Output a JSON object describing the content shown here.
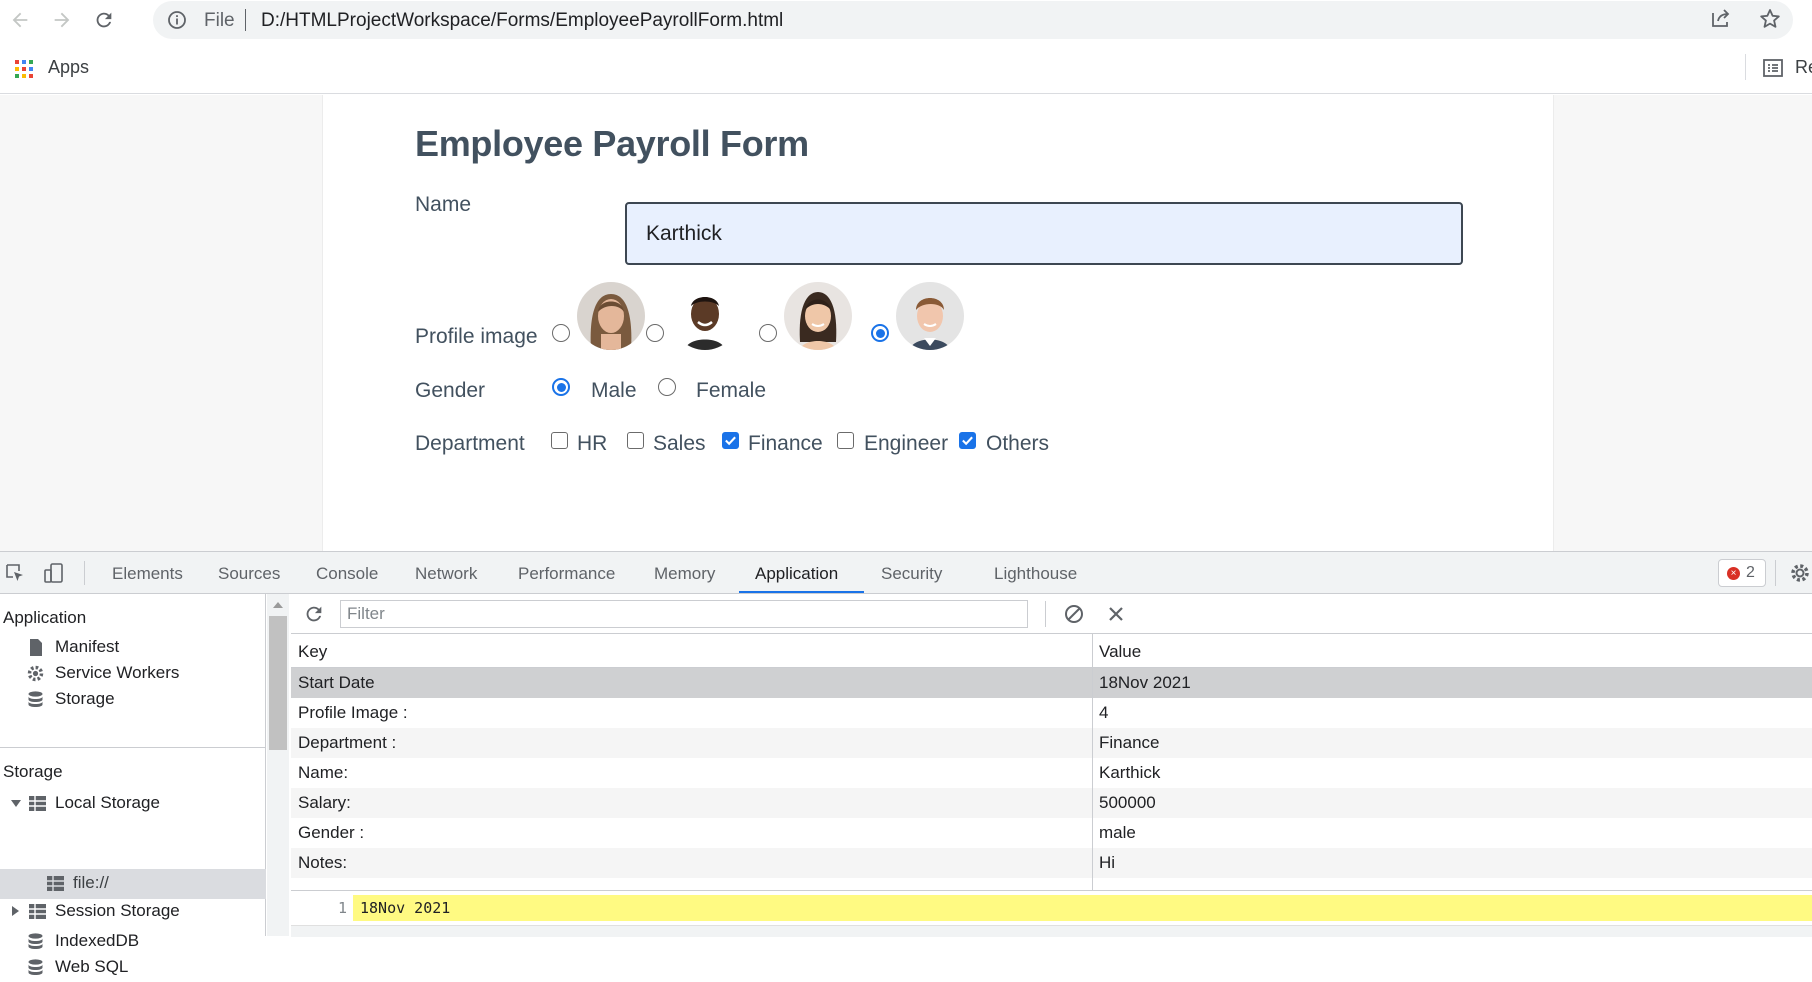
{
  "browser": {
    "url_scheme": "File",
    "url": "D:/HTMLProjectWorkspace/Forms/EmployeePayrollForm.html",
    "bookmarks": {
      "apps_label": "Apps",
      "reading_list_label": "Re"
    }
  },
  "form": {
    "title": "Employee Payroll Form",
    "name_label": "Name",
    "name_value": "Karthick",
    "profile_label": "Profile image",
    "profile_selected_index": 4,
    "gender_label": "Gender",
    "gender_options": [
      "Male",
      "Female"
    ],
    "gender_selected": "Male",
    "department_label": "Department",
    "departments": [
      {
        "label": "HR",
        "checked": false
      },
      {
        "label": "Sales",
        "checked": false
      },
      {
        "label": "Finance",
        "checked": true
      },
      {
        "label": "Engineer",
        "checked": false
      },
      {
        "label": "Others",
        "checked": true
      }
    ]
  },
  "devtools": {
    "tabs": [
      "Elements",
      "Sources",
      "Console",
      "Network",
      "Performance",
      "Memory",
      "Application",
      "Security",
      "Lighthouse"
    ],
    "active_tab": "Application",
    "error_count": "2",
    "sidebar": {
      "application_header": "Application",
      "application_items": [
        "Manifest",
        "Service Workers",
        "Storage"
      ],
      "storage_header": "Storage",
      "storage_items": [
        "Local Storage",
        "file://",
        "Session Storage",
        "IndexedDB",
        "Web SQL"
      ]
    },
    "storage": {
      "filter_placeholder": "Filter",
      "columns": [
        "Key",
        "Value"
      ],
      "rows": [
        {
          "key": "Start Date",
          "value": "18Nov 2021"
        },
        {
          "key": "Profile Image :",
          "value": "4"
        },
        {
          "key": "Department :",
          "value": "Finance"
        },
        {
          "key": "Name:",
          "value": "Karthick"
        },
        {
          "key": "Salary:",
          "value": "500000"
        },
        {
          "key": "Gender :",
          "value": "male"
        },
        {
          "key": "Notes:",
          "value": "Hi"
        }
      ],
      "selected_row": 0,
      "preview_line_number": "1",
      "preview_text": "18Nov 2021"
    }
  },
  "colors": {
    "accent": "#1a73e8",
    "form_text": "#42515f",
    "input_bg": "#e8f0fe",
    "preview_highlight": "#fffa82"
  }
}
